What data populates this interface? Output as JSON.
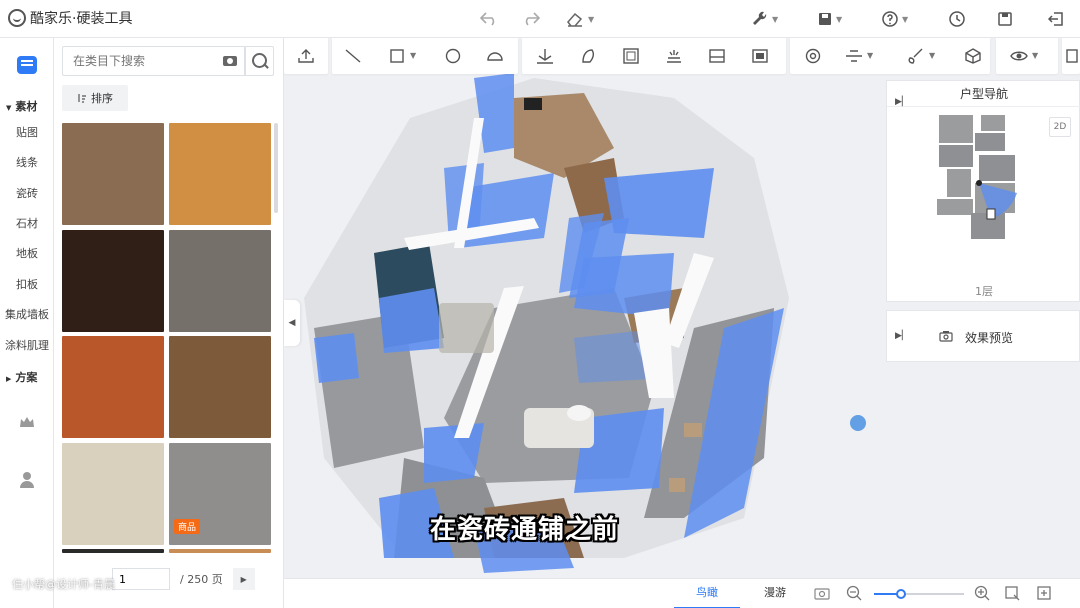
{
  "app": {
    "title": "酷家乐·硬装工具"
  },
  "left_nav": {
    "groups": [
      {
        "label": "素材",
        "items": [
          "贴图",
          "线条",
          "瓷砖",
          "石材",
          "地板",
          "扣板",
          "集成墙板",
          "涂料肌理"
        ]
      },
      {
        "label": "方案",
        "items": []
      }
    ]
  },
  "material_panel": {
    "search_placeholder": "在类目下搜索",
    "sort_label": "排序",
    "tiles": [
      {
        "color": "#8a6c52"
      },
      {
        "color": "#d08f43"
      },
      {
        "color": "#2f1f17"
      },
      {
        "color": "#75706a"
      },
      {
        "color": "#b9572b"
      },
      {
        "color": "#7d5a3a"
      },
      {
        "color": "#d9d1bd"
      },
      {
        "color": "#8f8e8c"
      }
    ],
    "badge": "商品",
    "pager": {
      "page": "1",
      "total": "/ 250 页"
    }
  },
  "nav_panel": {
    "title": "户型导航",
    "mode_button": "2D",
    "floor": "1层"
  },
  "preview_panel": {
    "title": "效果预览"
  },
  "bottom_bar": {
    "modes": [
      "鸟瞰",
      "漫游"
    ],
    "zoom_level": 0.3
  },
  "subtitle": "在瓷砖通铺之前",
  "watermark": "住小帮@设计师-青晨",
  "colors": {
    "accent": "#2f7bf5",
    "badge": "#f56a16",
    "glass": "#5e8ef0"
  }
}
